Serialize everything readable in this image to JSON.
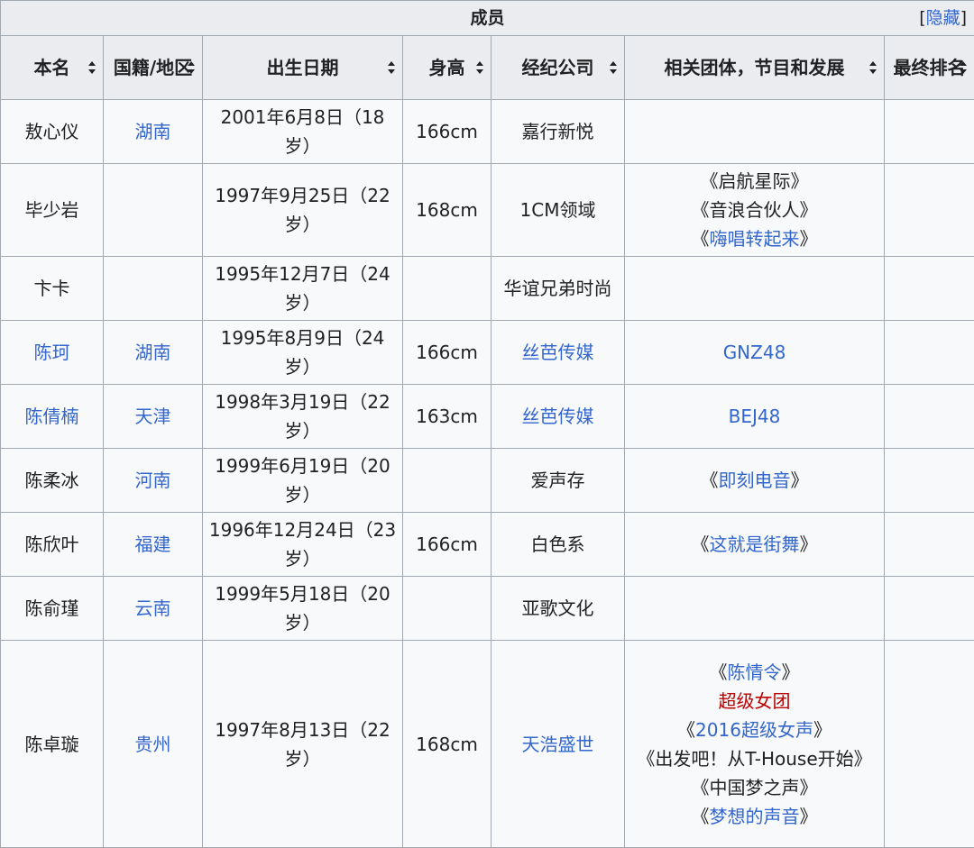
{
  "table": {
    "caption": "成员",
    "hide_toggle": {
      "open": "[",
      "label": "隐藏",
      "close": "]"
    },
    "columns": [
      "本名",
      "国籍/地区",
      "出生日期",
      "身高",
      "经纪公司",
      "相关团体，节目和发展",
      "最终排名"
    ],
    "rows": [
      {
        "name": {
          "text": "敖心仪"
        },
        "region": {
          "text": "湖南",
          "link": true
        },
        "birth": "2001年6月8日（18岁）",
        "height": "166cm",
        "agency": {
          "text": "嘉行新悦"
        },
        "related": [],
        "rank": ""
      },
      {
        "name": {
          "text": "毕少岩"
        },
        "region": {
          "text": ""
        },
        "birth": "1997年9月25日（22岁）",
        "height": "168cm",
        "agency": {
          "text": "1CM领域"
        },
        "related": [
          {
            "text": "《启航星际》"
          },
          {
            "text": "《音浪合伙人》"
          },
          {
            "pre": "《",
            "text": "嗨唱转起来",
            "post": "》",
            "link": true
          }
        ],
        "rank": ""
      },
      {
        "name": {
          "text": "卞卡"
        },
        "region": {
          "text": ""
        },
        "birth": "1995年12月7日（24岁）",
        "height": "",
        "agency": {
          "text": "华谊兄弟时尚"
        },
        "related": [],
        "rank": ""
      },
      {
        "name": {
          "text": "陈珂",
          "link": true
        },
        "region": {
          "text": "湖南",
          "link": true
        },
        "birth": "1995年8月9日（24岁）",
        "height": "166cm",
        "agency": {
          "text": "丝芭传媒",
          "link": true
        },
        "related": [
          {
            "text": "GNZ48",
            "link": true
          }
        ],
        "rank": ""
      },
      {
        "name": {
          "text": "陈倩楠",
          "link": true
        },
        "region": {
          "text": "天津",
          "link": true
        },
        "birth": "1998年3月19日（22岁）",
        "height": "163cm",
        "agency": {
          "text": "丝芭传媒",
          "link": true
        },
        "related": [
          {
            "text": "BEJ48",
            "link": true
          }
        ],
        "rank": ""
      },
      {
        "name": {
          "text": "陈柔冰"
        },
        "region": {
          "text": "河南",
          "link": true
        },
        "birth": "1999年6月19日（20岁）",
        "height": "",
        "agency": {
          "text": "爱声存"
        },
        "related": [
          {
            "pre": "《",
            "text": "即刻电音",
            "post": "》",
            "link": true
          }
        ],
        "rank": ""
      },
      {
        "name": {
          "text": "陈欣叶"
        },
        "region": {
          "text": "福建",
          "link": true
        },
        "birth": "1996年12月24日（23岁）",
        "height": "166cm",
        "agency": {
          "text": "白色系"
        },
        "related": [
          {
            "pre": "《",
            "text": "这就是街舞",
            "post": "》",
            "link": true
          }
        ],
        "rank": ""
      },
      {
        "name": {
          "text": "陈俞瑾"
        },
        "region": {
          "text": "云南",
          "link": true
        },
        "birth": "1999年5月18日（20岁）",
        "height": "",
        "agency": {
          "text": "亚歌文化"
        },
        "related": [],
        "rank": ""
      },
      {
        "name": {
          "text": "陈卓璇"
        },
        "region": {
          "text": "贵州",
          "link": true
        },
        "birth": "1997年8月13日（22岁）",
        "height": "168cm",
        "agency": {
          "text": "天浩盛世",
          "link": true
        },
        "related": [
          {
            "pre": "《",
            "text": "陈情令",
            "post": "》",
            "link": true
          },
          {
            "text": "超级女团",
            "red": true
          },
          {
            "pre": "《",
            "text": "2016超级女声",
            "post": "》",
            "link": true
          },
          {
            "text": "《出发吧！从T-House开始》"
          },
          {
            "text": "《中国梦之声》"
          },
          {
            "pre": "《",
            "text": "梦想的声音",
            "post": "》",
            "link": true
          }
        ],
        "rank": ""
      }
    ]
  }
}
